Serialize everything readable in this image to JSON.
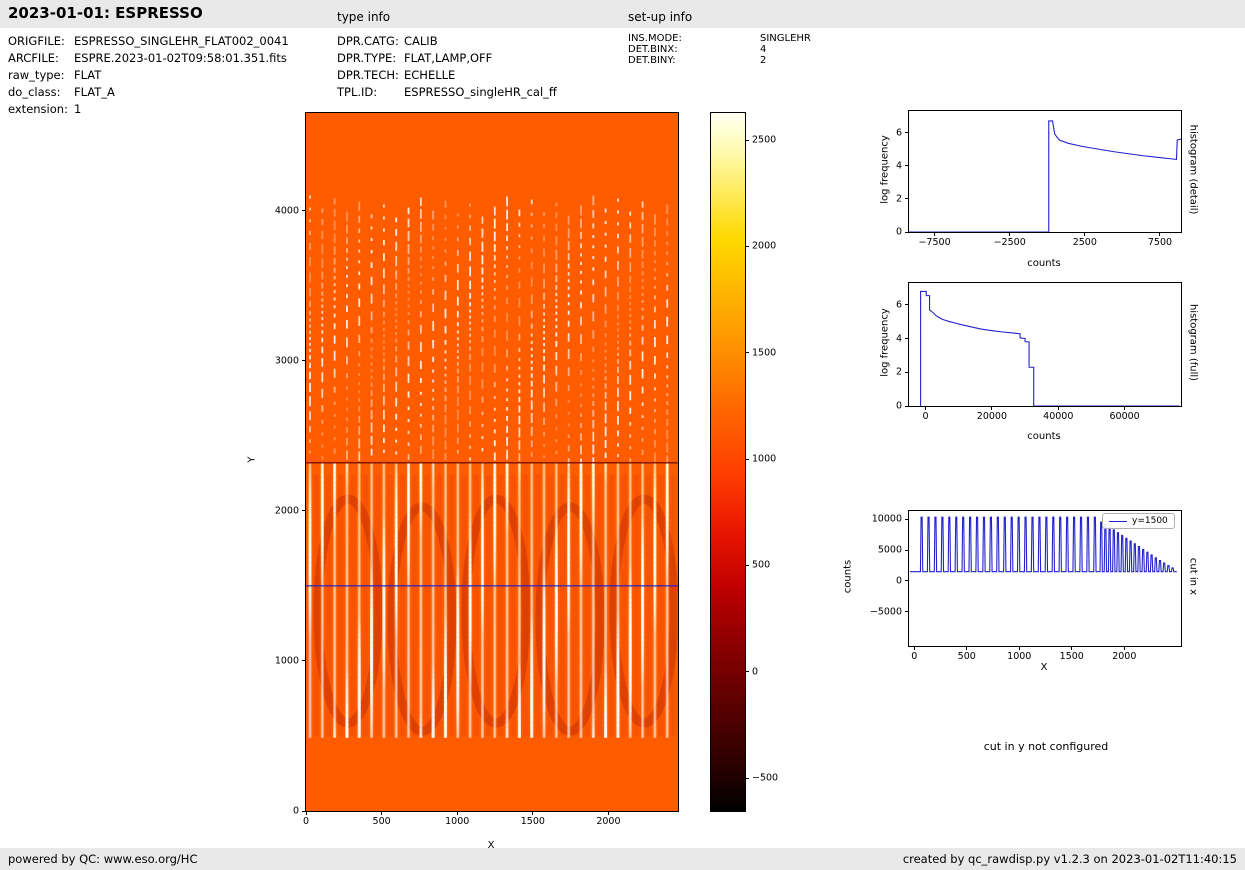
{
  "header": {
    "title": "2023-01-01: ESPRESSO",
    "type_info_label": "type info",
    "setup_info_label": "set-up info"
  },
  "metadata": {
    "left": [
      {
        "label": "ORIGFILE:",
        "value": "ESPRESSO_SINGLEHR_FLAT002_0041"
      },
      {
        "label": "ARCFILE:",
        "value": "ESPRE.2023-01-02T09:58:01.351.fits"
      },
      {
        "label": "raw_type:",
        "value": "FLAT"
      },
      {
        "label": "do_class:",
        "value": "FLAT_A"
      },
      {
        "label": "extension:",
        "value": "1"
      }
    ],
    "type_info": [
      {
        "label": "DPR.CATG:",
        "value": "CALIB"
      },
      {
        "label": "DPR.TYPE:",
        "value": "FLAT,LAMP,OFF"
      },
      {
        "label": "DPR.TECH:",
        "value": "ECHELLE"
      },
      {
        "label": "TPL.ID:",
        "value": "ESPRESSO_singleHR_cal_ff"
      }
    ],
    "setup_info": [
      {
        "label": "INS.MODE:",
        "value": "SINGLEHR"
      },
      {
        "label": "DET.BINX:",
        "value": "4"
      },
      {
        "label": "DET.BINY:",
        "value": "2"
      }
    ]
  },
  "labels": {
    "cut_y_note": "cut in y not configured"
  },
  "footer": {
    "left": "powered by QC: www.eso.org/HC",
    "right": "created by qc_rawdisp.py v1.2.3 on 2023-01-02T11:40:15"
  },
  "chart_data": [
    {
      "id": "raw-image",
      "type": "heatmap",
      "content_summary": "ESPRESSO raw flat-field frame; ~30 bright vertical echelle-order stripes on orange background, dashed in upper half, solid in lower-middle, plain orange at top and bottom",
      "xlabel": "X",
      "ylabel": "Y",
      "xlim": [
        0,
        2460
      ],
      "ylim": [
        0,
        4650
      ],
      "xticks": [
        0,
        500,
        1000,
        1500,
        2000
      ],
      "yticks": [
        0,
        1000,
        2000,
        3000,
        4000
      ],
      "features": {
        "stripe_count": 30,
        "solid_stripe_region_y": [
          500,
          2320
        ],
        "dashed_stripe_region_y": [
          2320,
          4100
        ],
        "dark_row_y": 2320,
        "blue_cut_line_y": 1500
      },
      "base_color": "#ff5c00",
      "colorbar": {
        "colormap": "hot",
        "vmin": -655,
        "vmax": 2627,
        "ticks": [
          -500,
          0,
          500,
          1000,
          1500,
          2000,
          2500
        ]
      }
    },
    {
      "id": "histogram-detail",
      "type": "line",
      "right_label": "histogram (detail)",
      "xlabel": "counts",
      "ylabel": "log frequency",
      "xlim": [
        -9200,
        8900
      ],
      "ylim": [
        0,
        7.3
      ],
      "xticks": [
        -7500,
        -2500,
        2500,
        7500
      ],
      "yticks": [
        0,
        2,
        4,
        6
      ],
      "color": "#2222cc",
      "points": [
        [
          -9200,
          0
        ],
        [
          100,
          0
        ],
        [
          100,
          6.7
        ],
        [
          350,
          6.7
        ],
        [
          500,
          5.9
        ],
        [
          800,
          5.55
        ],
        [
          1400,
          5.35
        ],
        [
          2400,
          5.15
        ],
        [
          3400,
          5.0
        ],
        [
          4400,
          4.85
        ],
        [
          5400,
          4.72
        ],
        [
          6400,
          4.6
        ],
        [
          7400,
          4.5
        ],
        [
          8200,
          4.42
        ],
        [
          8600,
          4.38
        ],
        [
          8650,
          5.55
        ],
        [
          8900,
          5.6
        ]
      ]
    },
    {
      "id": "histogram-full",
      "type": "line",
      "right_label": "histogram (full)",
      "xlabel": "counts",
      "ylabel": "log frequency",
      "xlim": [
        -5000,
        77000
      ],
      "ylim": [
        0,
        7.3
      ],
      "xticks": [
        0,
        20000,
        40000,
        60000
      ],
      "yticks": [
        0,
        2,
        4,
        6
      ],
      "color": "#2222cc",
      "points": [
        [
          -1500,
          0
        ],
        [
          -1500,
          6.8
        ],
        [
          200,
          6.8
        ],
        [
          200,
          6.55
        ],
        [
          1200,
          6.55
        ],
        [
          1200,
          5.7
        ],
        [
          2200,
          5.55
        ],
        [
          3200,
          5.35
        ],
        [
          5000,
          5.15
        ],
        [
          7000,
          5.02
        ],
        [
          9000,
          4.92
        ],
        [
          11000,
          4.82
        ],
        [
          13000,
          4.73
        ],
        [
          15000,
          4.64
        ],
        [
          17000,
          4.56
        ],
        [
          19000,
          4.5
        ],
        [
          21000,
          4.45
        ],
        [
          23000,
          4.4
        ],
        [
          25000,
          4.36
        ],
        [
          27000,
          4.32
        ],
        [
          28500,
          4.28
        ],
        [
          28500,
          4.05
        ],
        [
          30000,
          4.0
        ],
        [
          30000,
          3.82
        ],
        [
          31200,
          3.8
        ],
        [
          31200,
          2.3
        ],
        [
          32600,
          2.3
        ],
        [
          32600,
          0
        ],
        [
          76500,
          0
        ]
      ]
    },
    {
      "id": "cut-in-x",
      "type": "line",
      "right_label": "cut in x",
      "xlabel": "X",
      "ylabel": "counts",
      "legend_label": "y=1500",
      "xlim": [
        -50,
        2540
      ],
      "ylim": [
        -10500,
        11300
      ],
      "xticks": [
        0,
        500,
        1000,
        1500,
        2000
      ],
      "yticks": [
        -5000,
        0,
        5000,
        10000
      ],
      "color": "#2222cc",
      "baseline": 1500,
      "spikes": [
        [
          70,
          10300
        ],
        [
          136,
          10300
        ],
        [
          202,
          10300
        ],
        [
          268,
          10300
        ],
        [
          334,
          10300
        ],
        [
          400,
          10300
        ],
        [
          466,
          10300
        ],
        [
          532,
          10300
        ],
        [
          598,
          10300
        ],
        [
          664,
          10300
        ],
        [
          730,
          10300
        ],
        [
          796,
          10300
        ],
        [
          862,
          10300
        ],
        [
          928,
          10300
        ],
        [
          994,
          10300
        ],
        [
          1060,
          10300
        ],
        [
          1126,
          10300
        ],
        [
          1192,
          10300
        ],
        [
          1258,
          10300
        ],
        [
          1324,
          10300
        ],
        [
          1390,
          10300
        ],
        [
          1456,
          10300
        ],
        [
          1522,
          10300
        ],
        [
          1588,
          10300
        ],
        [
          1654,
          10300
        ],
        [
          1720,
          10300
        ],
        [
          1780,
          9500
        ],
        [
          1820,
          9100
        ],
        [
          1860,
          8700
        ],
        [
          1900,
          8250
        ],
        [
          1940,
          7800
        ],
        [
          1980,
          7350
        ],
        [
          2020,
          6900
        ],
        [
          2060,
          6450
        ],
        [
          2100,
          6000
        ],
        [
          2140,
          5550
        ],
        [
          2180,
          5100
        ],
        [
          2220,
          4650
        ],
        [
          2260,
          4200
        ],
        [
          2300,
          3750
        ],
        [
          2340,
          3300
        ],
        [
          2380,
          2900
        ],
        [
          2420,
          2500
        ],
        [
          2460,
          2100
        ]
      ]
    }
  ]
}
